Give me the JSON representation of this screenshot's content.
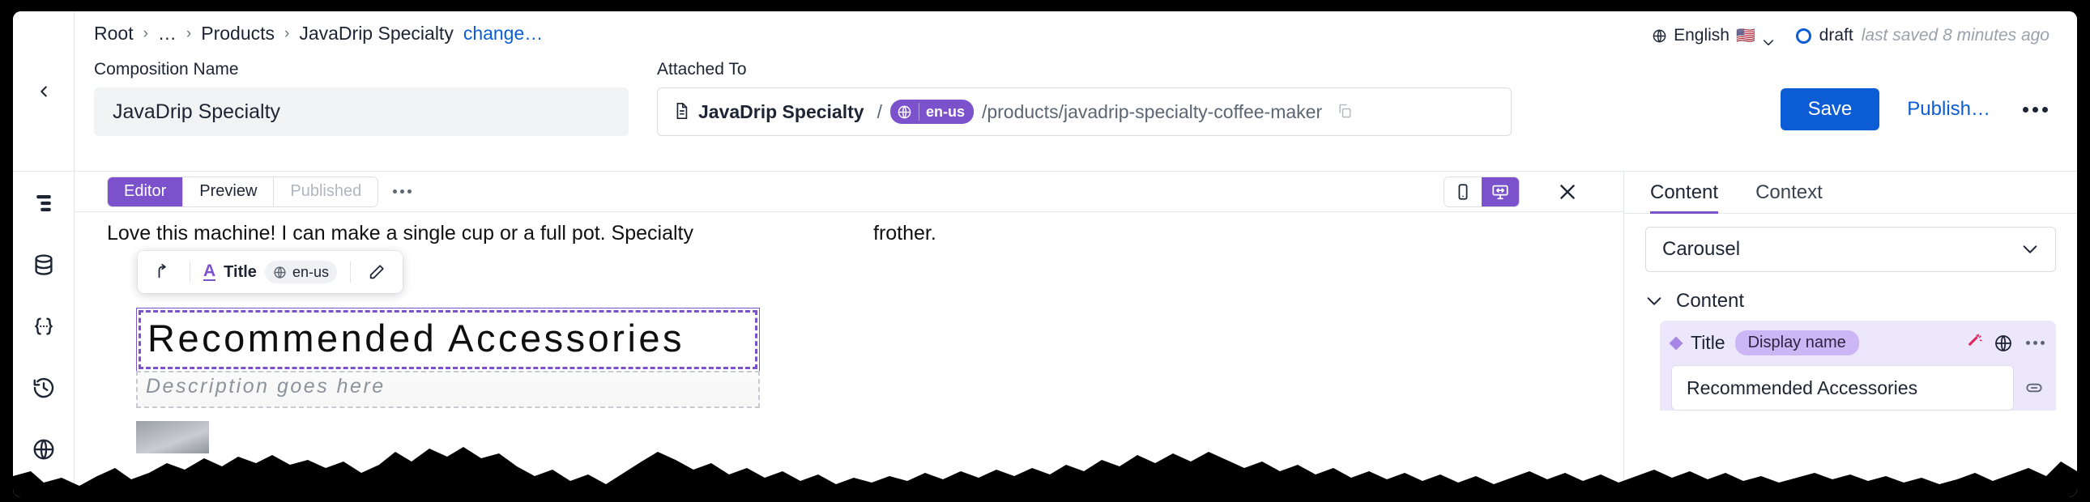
{
  "header": {
    "back_icon": "chevron-left-icon",
    "breadcrumb": {
      "items": [
        "Root",
        "…",
        "Products",
        "JavaDrip Specialty"
      ],
      "separator": "›",
      "change_link": "change…"
    },
    "composition_name": {
      "label": "Composition Name",
      "value": "JavaDrip Specialty"
    },
    "attached_to": {
      "label": "Attached To",
      "doc_icon": "document-icon",
      "title": "JavaDrip Specialty",
      "slash": "/",
      "locale_globe_icon": "globe-icon",
      "locale": "en-us",
      "path": "/products/javadrip-specialty-coffee-maker",
      "copy_icon": "copy-icon"
    },
    "language_selector": {
      "globe_icon": "globe-icon",
      "label": "English",
      "flag": "🇺🇸",
      "chevron_icon": "chevron-down-icon"
    },
    "status": {
      "ring_icon": "circle-outline-icon",
      "label": "draft",
      "last_saved": "last saved 8 minutes ago"
    },
    "actions": {
      "save_label": "Save",
      "publish_label": "Publish…",
      "more_icon": "kebab-menu-icon"
    }
  },
  "sidebar": {
    "items": [
      {
        "icon": "menu-lines-icon",
        "name": "pages"
      },
      {
        "icon": "database-icon",
        "name": "content"
      },
      {
        "icon": "code-braces-icon",
        "name": "code"
      },
      {
        "icon": "history-clock-icon",
        "name": "history"
      },
      {
        "icon": "globe-icon",
        "name": "locales"
      }
    ]
  },
  "editor": {
    "tabs": [
      {
        "label": "Editor",
        "state": "active"
      },
      {
        "label": "Preview",
        "state": "default"
      },
      {
        "label": "Published",
        "state": "disabled"
      }
    ],
    "tabs_more_icon": "kebab-menu-icon",
    "device_toggle": [
      {
        "icon": "mobile-icon",
        "state": "default"
      },
      {
        "icon": "responsive-desktop-icon",
        "state": "active"
      }
    ],
    "close_icon": "close-icon",
    "canvas": {
      "paragraph_left": "Love this machine! I can make a single cup or a full pot. Specialty",
      "paragraph_right": "frother.",
      "float_toolbar": {
        "move_up_icon": "arrow-up-left-icon",
        "type_glyph": "A",
        "type_label": "Title",
        "locale_globe_icon": "globe-icon",
        "locale": "en-us",
        "edit_icon": "pencil-icon"
      },
      "heading": "Recommended Accessories",
      "description_placeholder": "Description goes here"
    }
  },
  "right_panel": {
    "tabs": [
      {
        "label": "Content",
        "state": "active"
      },
      {
        "label": "Context",
        "state": "default"
      }
    ],
    "component_select": {
      "value": "Carousel",
      "chevron_icon": "chevron-down-icon"
    },
    "section": {
      "label": "Content",
      "chevron_icon": "chevron-down-icon",
      "field": {
        "bullet_icon": "diamond-bullet-icon",
        "label": "Title",
        "badge": "Display name",
        "wand_icon": "magic-wand-icon",
        "globe_icon": "globe-icon",
        "more_icon": "kebab-menu-icon",
        "value": "Recommended Accessories",
        "trailing_icon": "pill-toggle-icon"
      }
    }
  },
  "colors": {
    "accent_purple": "#7b52cc",
    "primary_blue": "#0b5cd5",
    "badge_purple": "#cdb6f5",
    "card_bg": "#ece7fb",
    "wand_pink": "#e0245e"
  }
}
